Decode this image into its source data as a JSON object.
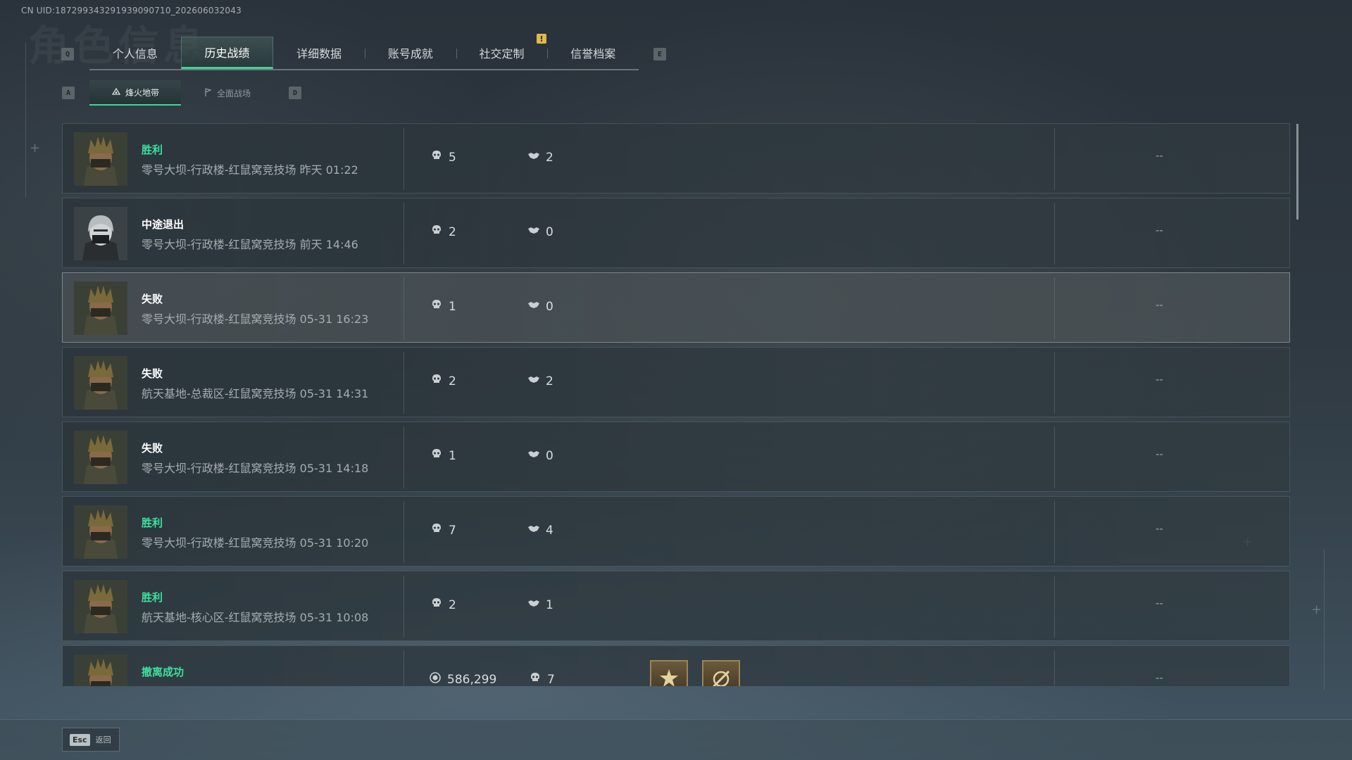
{
  "header": {
    "uid": "CN UID:187299343291939090710_202606032043"
  },
  "keys": {
    "prev_tab": "Q",
    "next_tab": "E",
    "prev_sub": "A",
    "next_sub": "D"
  },
  "tabs": [
    {
      "label": "个人信息",
      "active": false
    },
    {
      "label": "历史战绩",
      "active": true
    },
    {
      "label": "详细数据",
      "active": false
    },
    {
      "label": "账号成就",
      "active": false
    },
    {
      "label": "社交定制",
      "active": false
    },
    {
      "label": "信誉档案",
      "active": false
    }
  ],
  "alert_badge": "!",
  "subtabs": [
    {
      "label": "烽火地带",
      "active": true
    },
    {
      "label": "全面战场",
      "active": false
    }
  ],
  "matches": [
    {
      "result": "胜利",
      "win": true,
      "map": "零号大坝-行政楼-红鼠窝竞技场",
      "time": "昨天 01:22",
      "kills": "5",
      "assists": "2",
      "extra": "--"
    },
    {
      "result": "中途退出",
      "win": false,
      "map": "零号大坝-行政楼-红鼠窝竞技场",
      "time": "前天 14:46",
      "kills": "2",
      "assists": "0",
      "extra": "--"
    },
    {
      "result": "失败",
      "win": false,
      "map": "零号大坝-行政楼-红鼠窝竞技场",
      "time": "05-31 16:23",
      "kills": "1",
      "assists": "0",
      "extra": "--"
    },
    {
      "result": "失败",
      "win": false,
      "map": "航天基地-总裁区-红鼠窝竞技场",
      "time": "05-31 14:31",
      "kills": "2",
      "assists": "2",
      "extra": "--"
    },
    {
      "result": "失败",
      "win": false,
      "map": "零号大坝-行政楼-红鼠窝竞技场",
      "time": "05-31 14:18",
      "kills": "1",
      "assists": "0",
      "extra": "--"
    },
    {
      "result": "胜利",
      "win": true,
      "map": "零号大坝-行政楼-红鼠窝竞技场",
      "time": "05-31 10:20",
      "kills": "7",
      "assists": "4",
      "extra": "--"
    },
    {
      "result": "胜利",
      "win": true,
      "map": "航天基地-核心区-红鼠窝竞技场",
      "time": "05-31 10:08",
      "kills": "2",
      "assists": "1",
      "extra": "--"
    }
  ],
  "partial_match": {
    "result": "撤离成功",
    "money": "586,299",
    "kills": "7",
    "extra": "--"
  },
  "footer": {
    "esc_key": "Esc",
    "esc_label": "返回"
  },
  "colors": {
    "accent": "#3fd59a",
    "win_text": "#3fe09e",
    "alert": "#e0b84a"
  },
  "icons": {
    "kills": "skull-icon",
    "assists": "handshake-icon",
    "money": "coin-icon"
  }
}
